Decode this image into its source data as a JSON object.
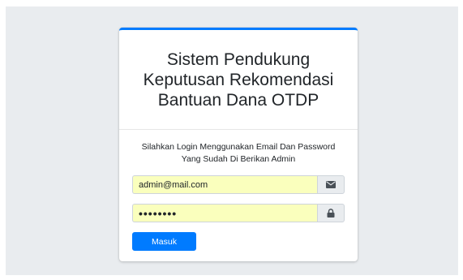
{
  "login": {
    "title": "Sistem Pendukung Keputusan Rekomendasi Bantuan Dana OTDP",
    "message": "Silahkan Login Menggunakan Email Dan Password Yang Sudah Di Berikan Admin",
    "email": {
      "value": "admin@mail.com",
      "icon": "envelope-icon"
    },
    "password": {
      "value": "password",
      "icon": "lock-icon"
    },
    "submit_label": "Masuk"
  },
  "colors": {
    "accent": "#007bff",
    "autofill": "#faffbd",
    "background": "#e9ecef"
  }
}
